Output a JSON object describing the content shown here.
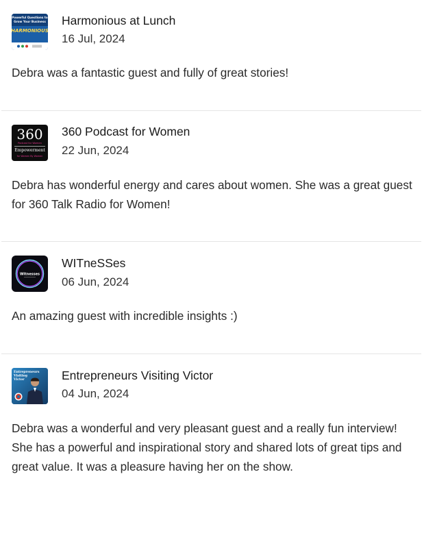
{
  "reviews": [
    {
      "podcast": "Harmonious at Lunch",
      "date": "16 Jul, 2024",
      "text": "Debra was a fantastic guest and fully of great stories!",
      "cover": {
        "icon": "harmonious-cover-art",
        "lines": [
          "Powerful Questions to",
          "Grow Your Business",
          "HARMONIOUS"
        ],
        "colors": {
          "bg": "#1b5fa8",
          "accent": "#ffd84a",
          "footer": "#ffffff"
        }
      }
    },
    {
      "podcast": "360 Podcast for Women",
      "date": "22 Jun, 2024",
      "text": "Debra has wonderful energy and cares about women. She was a great guest for 360 Talk Radio for Women!",
      "cover": {
        "icon": "360-podcast-cover-art",
        "lines": [
          "360",
          "Podcast for Women",
          "Empowerment",
          "for Women By Women"
        ],
        "colors": {
          "bg": "#0d0d0d",
          "text": "#ffffff",
          "accent": "#e2358d"
        }
      }
    },
    {
      "podcast": "WITneSSes",
      "date": "06 Jun, 2024",
      "text": "An amazing guest with incredible insights :)",
      "cover": {
        "icon": "witnesses-cover-art",
        "lines": [
          "Witnesses"
        ],
        "colors": {
          "bg": "#0b0b12",
          "ring": "#7fd8ff",
          "ring2": "#b44cff"
        }
      }
    },
    {
      "podcast": "Entrepreneurs Visiting Victor",
      "date": "04 Jun, 2024",
      "text": "Debra was a wonderful and very pleasant guest and a really fun interview! She has a powerful and inspirational story and shared lots of great tips and great value. It was a pleasure having her on the show.",
      "cover": {
        "icon": "entrepreneurs-visiting-victor-cover-art",
        "lines": [
          "Entrepreneurs",
          "Visiting",
          "Victor"
        ],
        "colors": {
          "bg": "#1f6fa8",
          "suit": "#1c2640",
          "badge": "#d33a2c"
        }
      }
    }
  ]
}
